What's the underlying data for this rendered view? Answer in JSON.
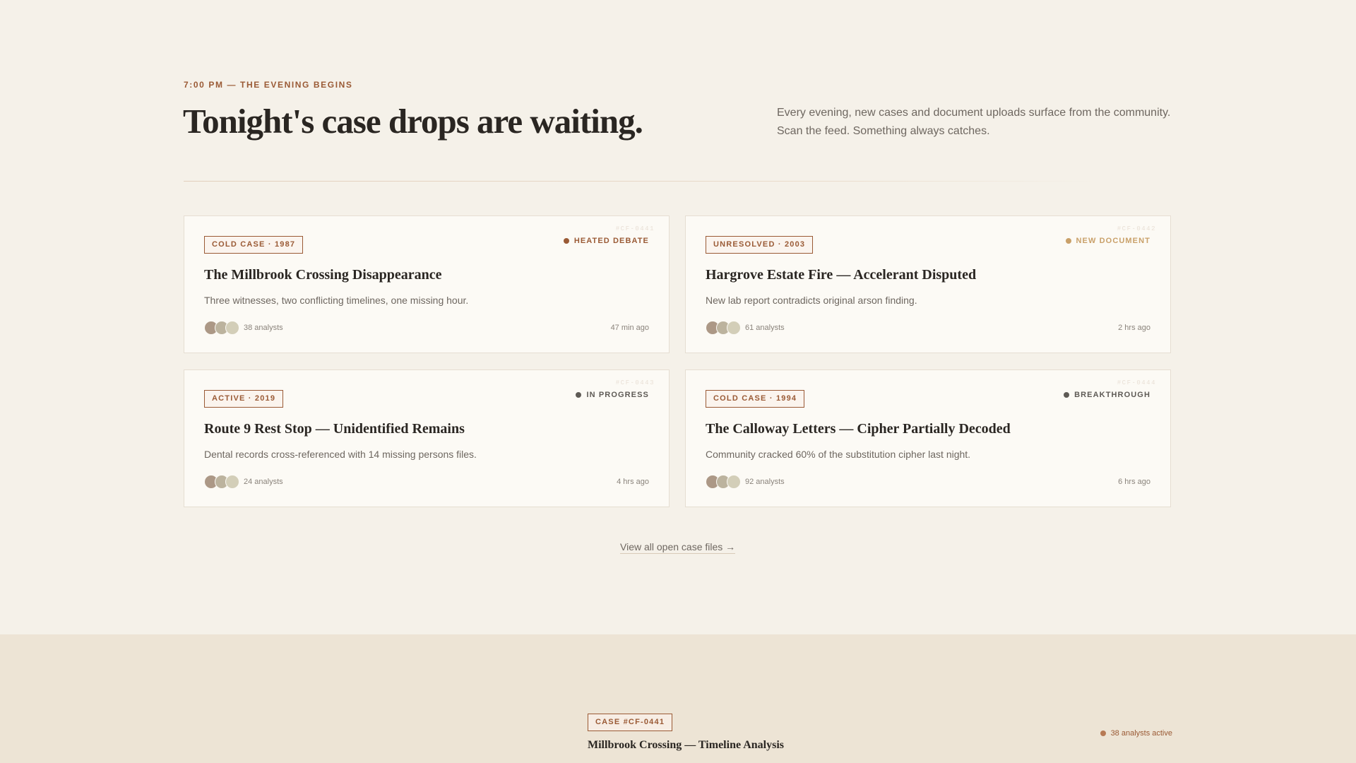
{
  "hero": {
    "eyebrow": "7:00 PM — THE EVENING BEGINS",
    "title": "Tonight's case drops are waiting.",
    "description": "Every evening, new cases and document uploads surface from the community. Scan the feed. Something always catches."
  },
  "cards": [
    {
      "id": "#CF-0441",
      "tag": "COLD CASE · 1987",
      "status": "HEATED DEBATE",
      "status_color": "#9a5a35",
      "title": "The Millbrook Crossing Disappearance",
      "description": "Three witnesses, two conflicting timelines, one missing hour.",
      "analysts": "38 analysts",
      "time": "47 min ago"
    },
    {
      "id": "#CF-0442",
      "tag": "UNRESOLVED · 2003",
      "status": "NEW DOCUMENT",
      "status_color": "#c9a069",
      "title": "Hargrove Estate Fire — Accelerant Disputed",
      "description": "New lab report contradicts original arson finding.",
      "analysts": "61 analysts",
      "time": "2 hrs ago"
    },
    {
      "id": "#CF-0443",
      "tag": "ACTIVE · 2019",
      "status": "IN PROGRESS",
      "status_color": "#5e5a55",
      "title": "Route 9 Rest Stop — Unidentified Remains",
      "description": "Dental records cross-referenced with 14 missing persons files.",
      "analysts": "24 analysts",
      "time": "4 hrs ago"
    },
    {
      "id": "#CF-0444",
      "tag": "COLD CASE · 1994",
      "status": "BREAKTHROUGH",
      "status_color": "#5e5a55",
      "title": "The Calloway Letters — Cipher Partially Decoded",
      "description": "Community cracked 60% of the substitution cipher last night.",
      "analysts": "92 analysts",
      "time": "6 hrs ago"
    }
  ],
  "view_all": "View all open case files →",
  "lower": {
    "tag": "CASE #CF-0441",
    "title": "Millbrook Crossing — Timeline Analysis",
    "active": "38 analysts active"
  }
}
